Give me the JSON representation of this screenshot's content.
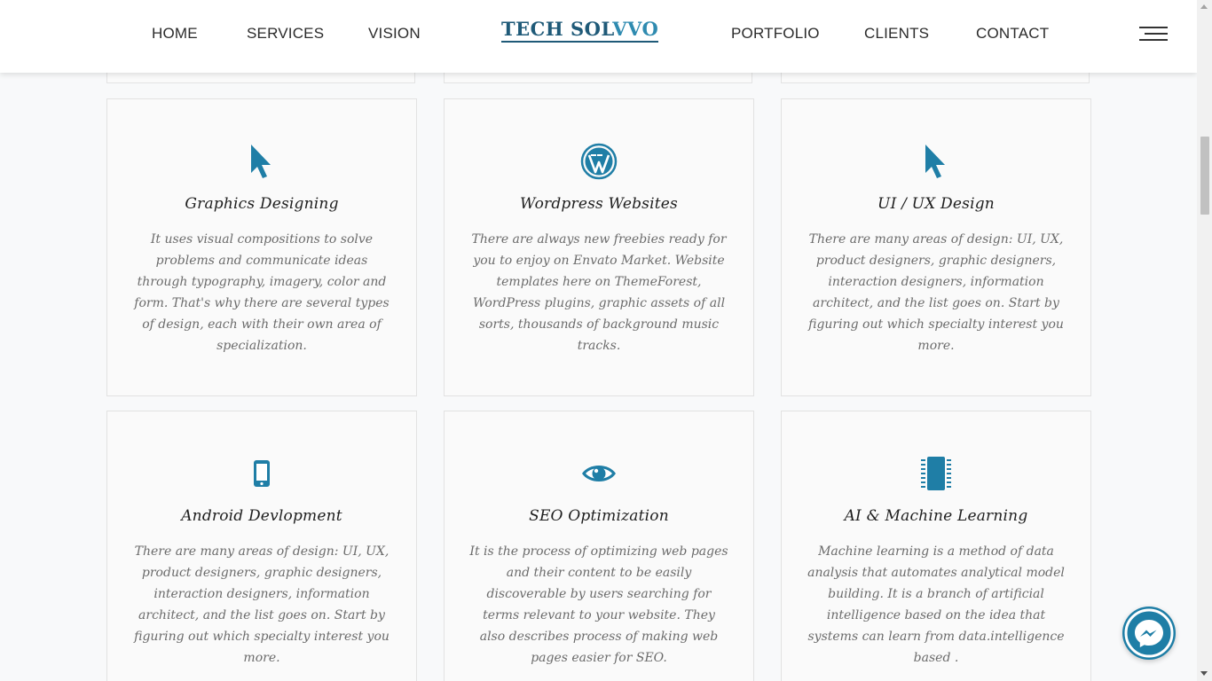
{
  "header": {
    "nav_left": [
      "HOME",
      "SERVICES",
      "VISION"
    ],
    "logo_part1": "TECH SOL",
    "logo_part2": "VVO",
    "nav_right": [
      "PORTFOLIO",
      "CLIENTS",
      "CONTACT"
    ]
  },
  "services": [
    {
      "icon": "cursor-icon",
      "title": "Graphics Designing",
      "description": "It uses visual compositions to solve problems and communicate ideas through typography, imagery, color and form. That's why there are several types of design, each with their own area of specialization."
    },
    {
      "icon": "wordpress-icon",
      "title": "Wordpress Websites",
      "description": "There are always new freebies ready for you to enjoy on Envato Market. Website templates here on ThemeForest, WordPress plugins, graphic assets of all sorts, thousands of background music tracks."
    },
    {
      "icon": "cursor-icon",
      "title": "UI / UX Design",
      "description": "There are many areas of design: UI, UX, product designers, graphic designers, interaction designers, information architect, and the list goes on. Start by figuring out which specialty interest you more."
    },
    {
      "icon": "mobile-phone-icon",
      "title": "Android Devlopment",
      "description": "There are many areas of design: UI, UX, product designers, graphic designers, interaction designers, information architect, and the list goes on. Start by figuring out which specialty interest you more."
    },
    {
      "icon": "eye-icon",
      "title": "SEO Optimization",
      "description": "It is the process of optimizing web pages and their content to be easily discoverable by users searching for terms relevant to your website. They also describes process of making web pages easier for SEO."
    },
    {
      "icon": "microchip-icon",
      "title": "AI & Machine Learning",
      "description": "Machine learning is a method of data analysis that automates analytical model building. It is a branch of artificial intelligence based on the idea that systems can learn from data.intelligence based ."
    }
  ],
  "colors": {
    "accent": "#1f7ea6",
    "logo": "#1f5a78",
    "background": "#f8f9fa"
  }
}
